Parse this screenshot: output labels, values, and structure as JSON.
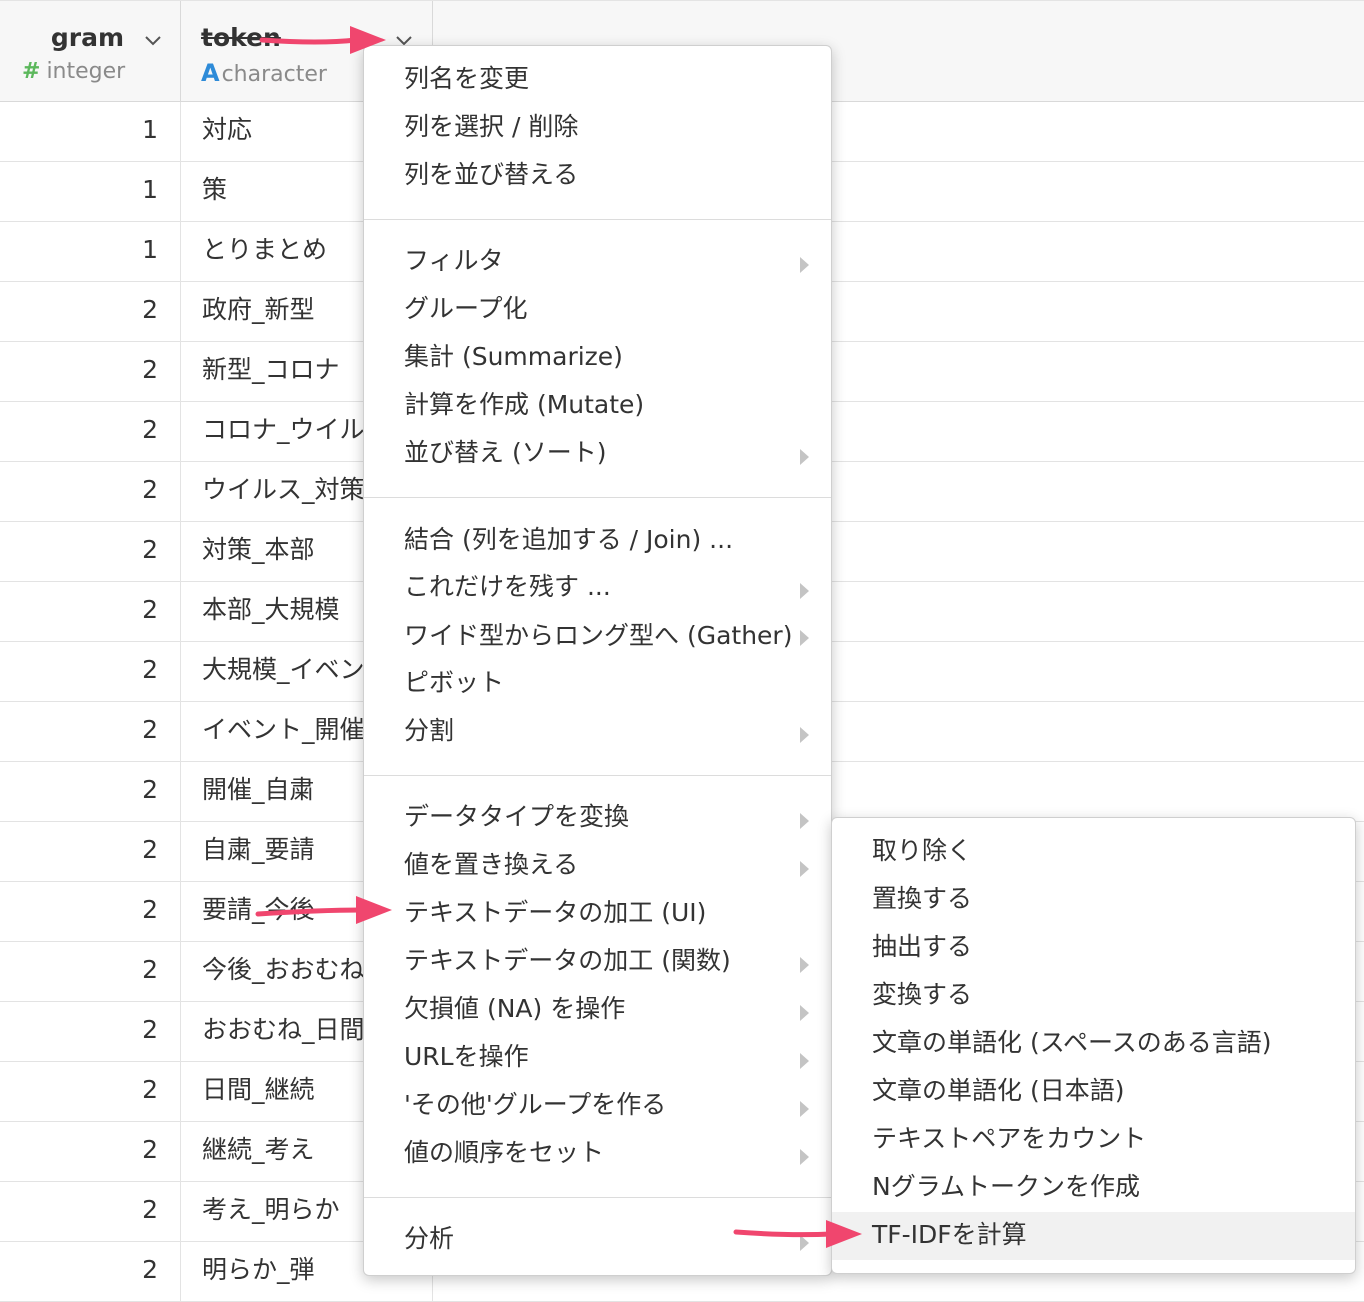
{
  "columns": {
    "gram": {
      "name": "gram",
      "type_symbol": "#",
      "type": "integer"
    },
    "token": {
      "name": "token",
      "type_symbol": "A",
      "type": "character"
    }
  },
  "rows": [
    {
      "gram": "1",
      "token": "対応"
    },
    {
      "gram": "1",
      "token": "策"
    },
    {
      "gram": "1",
      "token": "とりまとめ"
    },
    {
      "gram": "2",
      "token": "政府_新型"
    },
    {
      "gram": "2",
      "token": "新型_コロナ"
    },
    {
      "gram": "2",
      "token": "コロナ_ウイル"
    },
    {
      "gram": "2",
      "token": "ウイルス_対策"
    },
    {
      "gram": "2",
      "token": "対策_本部"
    },
    {
      "gram": "2",
      "token": "本部_大規模"
    },
    {
      "gram": "2",
      "token": "大規模_イベン"
    },
    {
      "gram": "2",
      "token": "イベント_開催"
    },
    {
      "gram": "2",
      "token": "開催_自粛"
    },
    {
      "gram": "2",
      "token": "自粛_要請"
    },
    {
      "gram": "2",
      "token": "要請_今後"
    },
    {
      "gram": "2",
      "token": "今後_おおむね"
    },
    {
      "gram": "2",
      "token": "おおむね_日間"
    },
    {
      "gram": "2",
      "token": "日間_継続"
    },
    {
      "gram": "2",
      "token": "継続_考え"
    },
    {
      "gram": "2",
      "token": "考え_明らか"
    },
    {
      "gram": "2",
      "token": "明らか_弾"
    }
  ],
  "menu": {
    "items": [
      "列名を変更",
      "列を選択 / 削除",
      "列を並び替える",
      "フィルタ",
      "グループ化",
      "集計 (Summarize)",
      "計算を作成 (Mutate)",
      "並び替え (ソート)",
      "結合 (列を追加する / Join) ...",
      "これだけを残す ...",
      "ワイド型からロング型へ (Gather)",
      "ピボット",
      "分割",
      "データタイプを変換",
      "値を置き換える",
      "テキストデータの加工 (UI)",
      "テキストデータの加工 (関数)",
      "欠損値 (NA) を操作",
      "URLを操作",
      "'その他'グループを作る",
      "値の順序をセット",
      "分析"
    ]
  },
  "submenu": {
    "items": [
      "取り除く",
      "置換する",
      "抽出する",
      "変換する",
      "文章の単語化 (スペースのある言語)",
      "文章の単語化 (日本語)",
      "テキストペアをカウント",
      "Nグラムトークンを作成",
      "TF-IDFを計算"
    ],
    "highlighted": "TF-IDFを計算"
  },
  "colors": {
    "annotation_arrow": "#f0466e",
    "integer_icon": "#5cb85c",
    "character_icon": "#2e8bd8",
    "highlight": "#f1f1f1"
  }
}
